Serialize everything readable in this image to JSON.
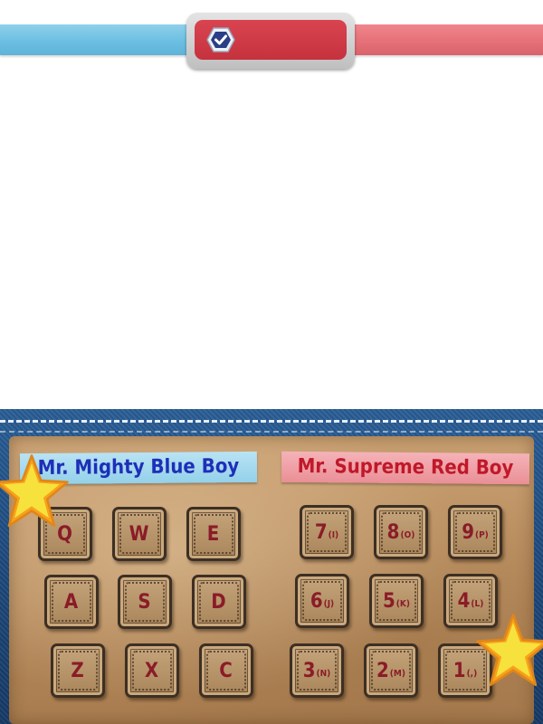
{
  "status_bar": {
    "check_icon": "check-hexagon-icon",
    "left_color": "#6cbfe2",
    "right_color": "#e56f76",
    "badge_color": "#c5323e"
  },
  "players": {
    "blue": {
      "name": "Mr. Mighty Blue Boy",
      "color": "#1e2fb8"
    },
    "red": {
      "name": "Mr. Supreme Red Boy",
      "color": "#c0182a"
    }
  },
  "keys": {
    "blue": [
      {
        "main": "Q",
        "sub": ""
      },
      {
        "main": "W",
        "sub": ""
      },
      {
        "main": "E",
        "sub": ""
      },
      {
        "main": "A",
        "sub": ""
      },
      {
        "main": "S",
        "sub": ""
      },
      {
        "main": "D",
        "sub": ""
      },
      {
        "main": "Z",
        "sub": ""
      },
      {
        "main": "X",
        "sub": ""
      },
      {
        "main": "C",
        "sub": ""
      }
    ],
    "red": [
      {
        "main": "7",
        "sub": "(I)"
      },
      {
        "main": "8",
        "sub": "(O)"
      },
      {
        "main": "9",
        "sub": "(P)"
      },
      {
        "main": "6",
        "sub": "(J)"
      },
      {
        "main": "5",
        "sub": "(K)"
      },
      {
        "main": "4",
        "sub": "(L)"
      },
      {
        "main": "3",
        "sub": "(N)"
      },
      {
        "main": "2",
        "sub": "(M)"
      },
      {
        "main": "1",
        "sub": "(,)"
      }
    ]
  }
}
